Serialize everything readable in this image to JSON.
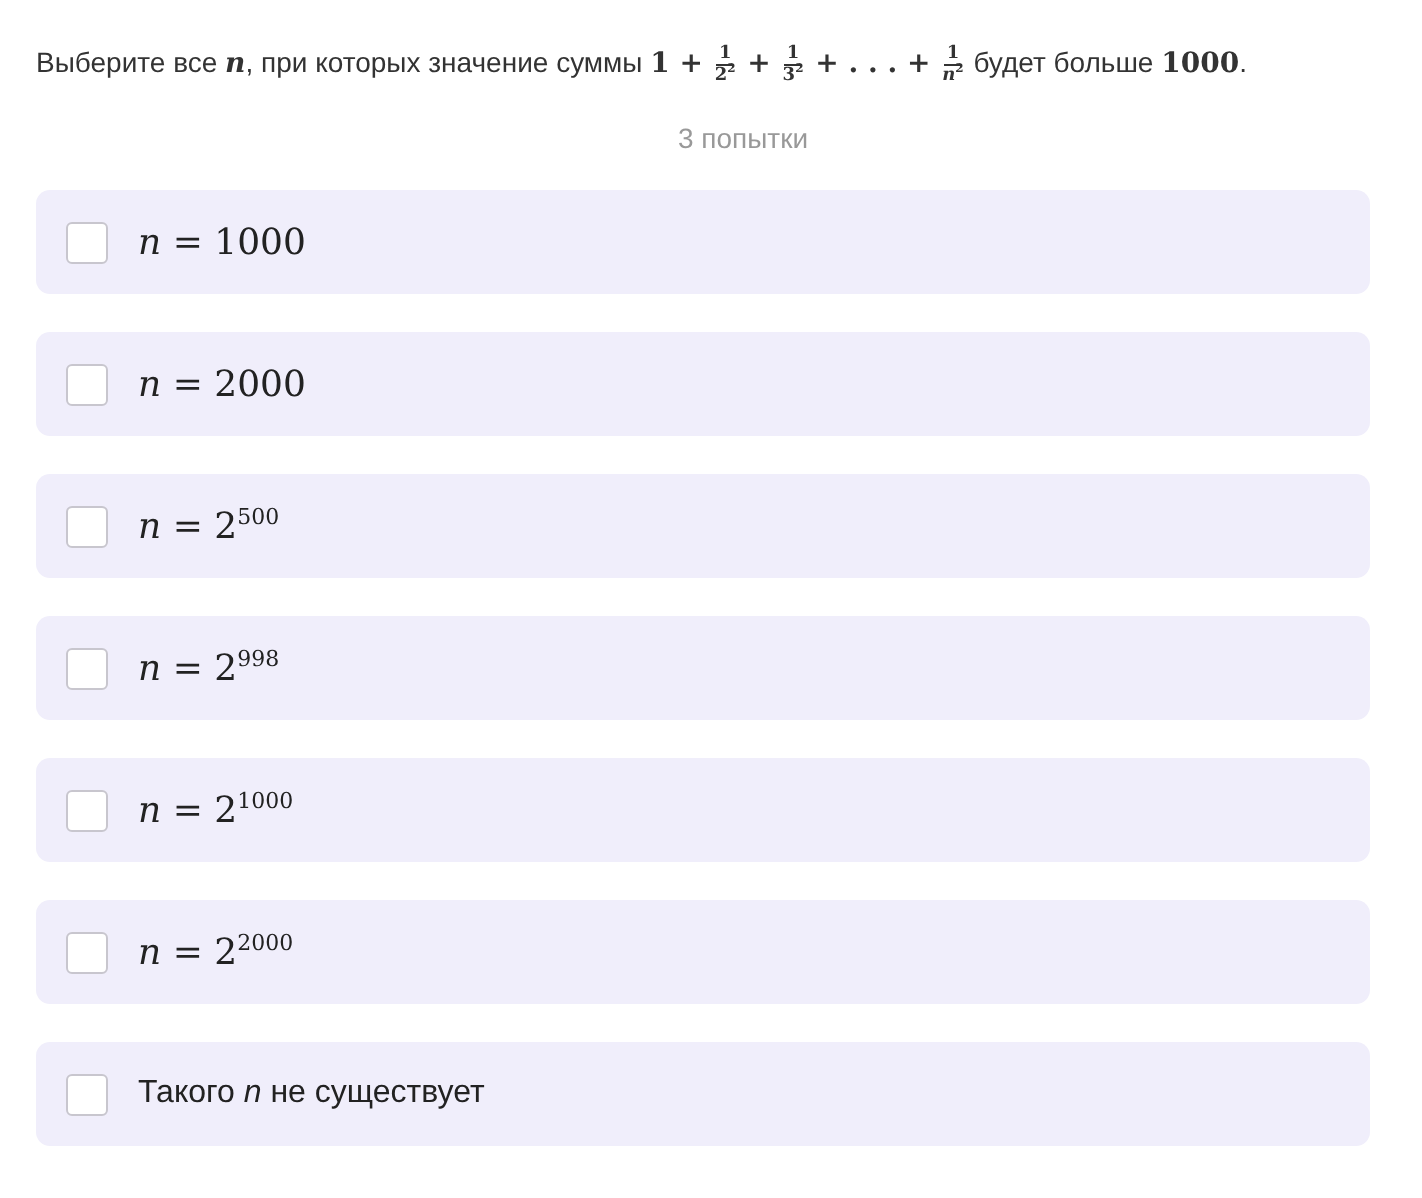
{
  "question": {
    "parts": [
      {
        "kind": "text",
        "text": "Выберите все "
      },
      {
        "kind": "math",
        "text": "n"
      },
      {
        "kind": "text",
        "text": ", при которых значение суммы "
      },
      {
        "kind": "math",
        "text": "1 + "
      },
      {
        "kind": "frac",
        "num": "1",
        "den": "2$^{2}$"
      },
      {
        "kind": "math",
        "text": " + "
      },
      {
        "kind": "frac",
        "num": "1",
        "den": "3$^{2}$"
      },
      {
        "kind": "math",
        "text": " + . . . + "
      },
      {
        "kind": "frac",
        "num": "1",
        "den": "*n*$^{2}$"
      },
      {
        "kind": "text",
        "text": " будет больше "
      },
      {
        "kind": "math",
        "text": "1000"
      },
      {
        "kind": "text",
        "text": "."
      }
    ]
  },
  "attempts": "3 попытки",
  "options": [
    {
      "kind": "math",
      "label": "*n* = 1000",
      "checked": false
    },
    {
      "kind": "math",
      "label": "*n* = 2000",
      "checked": false
    },
    {
      "kind": "math",
      "label": "*n* = 2$^{500}$",
      "checked": false
    },
    {
      "kind": "math",
      "label": "*n* = 2$^{998}$",
      "checked": false
    },
    {
      "kind": "math",
      "label": "*n* = 2$^{1000}$",
      "checked": false
    },
    {
      "kind": "math",
      "label": "*n* = 2$^{2000}$",
      "checked": false
    },
    {
      "kind": "text",
      "label": "Такого *n* не существует",
      "checked": false
    }
  ]
}
